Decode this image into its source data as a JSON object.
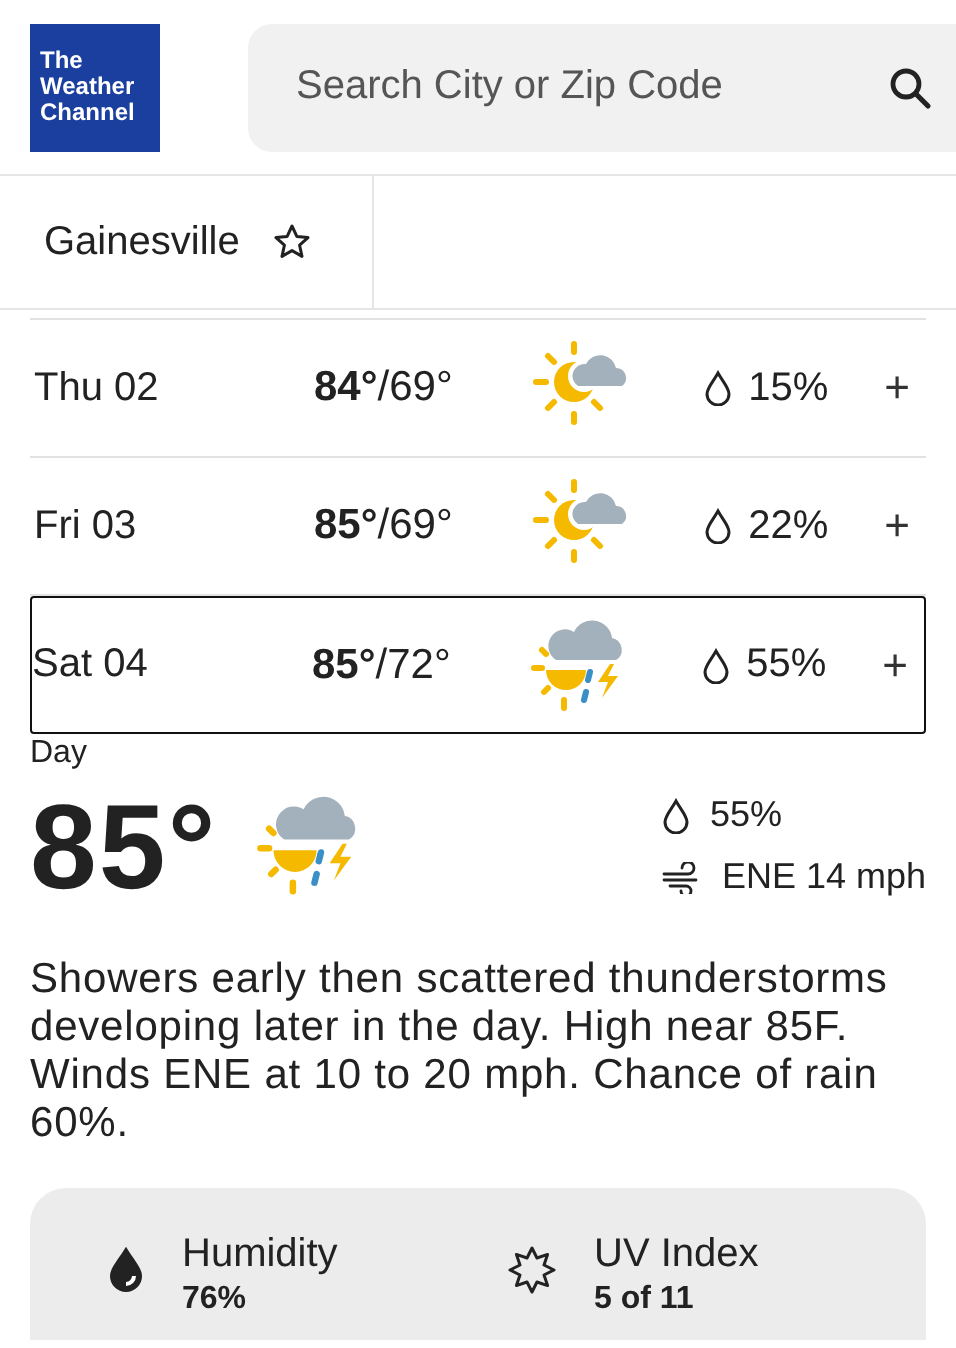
{
  "header": {
    "logo_lines": [
      "The",
      "Weather",
      "Channel"
    ],
    "search": {
      "placeholder": "Search City or Zip Code"
    }
  },
  "location_tab": {
    "label": "Gainesville",
    "favorite": false
  },
  "forecast_rows": [
    {
      "day": "Thu 02",
      "high": "84°",
      "low": "/69°",
      "kind": "partly-cloudy",
      "rain": "15%",
      "toggle": "+",
      "expanded": false
    },
    {
      "day": "Fri 03",
      "high": "85°",
      "low": "/69°",
      "kind": "partly-cloudy",
      "rain": "22%",
      "toggle": "+",
      "expanded": false
    },
    {
      "day": "Sat 04",
      "high": "85°",
      "low": "/72°",
      "kind": "thunderstorm",
      "rain": "55%",
      "toggle": "+",
      "expanded": true
    }
  ],
  "detail": {
    "period": "Day",
    "temperature": "85°",
    "kind": "thunderstorm",
    "rain": "55%",
    "wind": "ENE 14 mph",
    "description": "Showers early then scattered thunderstorms developing later in the day. High near 85F. Winds ENE at 10 to 20 mph. Chance of rain 60%.",
    "stats": [
      {
        "kind": "humidity",
        "label": "Humidity",
        "value": "76%"
      },
      {
        "kind": "uv",
        "label": "UV Index",
        "value": "5 of 11"
      }
    ]
  }
}
